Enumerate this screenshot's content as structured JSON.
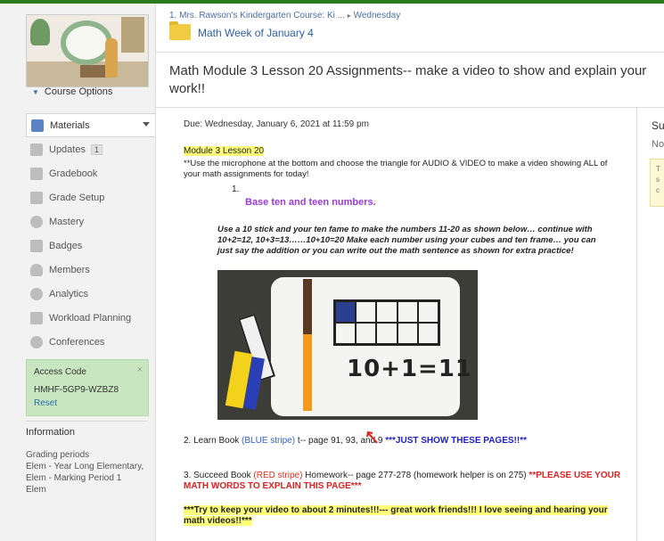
{
  "sidebar": {
    "course_options": "Course Options",
    "items": [
      {
        "label": "Materials",
        "active": true,
        "icon": "materials-icon"
      },
      {
        "label": "Updates",
        "count": "1",
        "icon": "updates-icon"
      },
      {
        "label": "Gradebook",
        "icon": "gradebook-icon"
      },
      {
        "label": "Grade Setup",
        "icon": "grade-setup-icon"
      },
      {
        "label": "Mastery",
        "icon": "mastery-icon"
      },
      {
        "label": "Badges",
        "icon": "badge-icon"
      },
      {
        "label": "Members",
        "icon": "members-icon"
      },
      {
        "label": "Analytics",
        "icon": "analytics-icon"
      },
      {
        "label": "Workload Planning",
        "icon": "workload-icon"
      },
      {
        "label": "Conferences",
        "icon": "conferences-icon"
      }
    ],
    "access_code": {
      "title": "Access Code",
      "code": "HMHF-5GP9-WZBZ8",
      "reset": "Reset",
      "close": "×"
    },
    "information": {
      "title": "Information",
      "grading_periods_label": "Grading periods",
      "periods": [
        "Elem - Year Long Elementary,",
        "Elem - Marking Period 1",
        "Elem"
      ]
    }
  },
  "header": {
    "breadcrumb_course": "1. Mrs. Rawson's Kindergarten Course: Ki ...",
    "breadcrumb_sep": "▸",
    "breadcrumb_folder": "Wednesday",
    "folder_title": "Math Week of January 4",
    "page_title": "Math Module 3 Lesson 20 Assignments-- make a video to show and explain your work!!"
  },
  "right_col": {
    "sub": "Sub",
    "no": "No",
    "yellow_lines": [
      "T",
      "s",
      "c"
    ]
  },
  "assignment": {
    "due": "Due: Wednesday, January 6, 2021 at 11:59 pm",
    "module": "Module 3  Lesson 20",
    "instructions": "**Use the microphone at the bottom and choose the triangle for AUDIO & VIDEO to make a video showing ALL of your math assignments for today!",
    "list_num": "1.",
    "base_ten": "Base ten and teen numbers.",
    "bold_instructions": "Use a 10 stick and your ten fame to make the numbers 11-20 as shown below… continue with 10+2=12, 10+3=13……10+10=20 Make each number using your cubes and ten frame… you can just say the addition or you can write out the math sentence as shown for extra practice!",
    "photo_equation": "10+1=11",
    "learn_prefix": "2.  Learn Book ",
    "learn_stripe": "(BLUE stripe)",
    "learn_pages": " t-- page 91, 93, and ",
    "learn_pages_end": "9",
    "learn_show": "***JUST SHOW THESE PAGES!!**",
    "succeed_prefix": "3.  Succeed Book ",
    "succeed_stripe": "(RED stripe)",
    "succeed_pages": " Homework-- page 277-278  (homework helper is on 275) ",
    "succeed_words": "**PLEASE USE YOUR MATH WORDS TO EXPLAIN THIS PAGE***",
    "try": "***Try to keep your video to about 2 minutes!!!--- great work friends!!!  I love seeing and hearing your math videos!!***"
  },
  "colors": {
    "accent_green": "#2b7a1e",
    "link_blue": "#2d5fa0",
    "purple": "#9b3bd6",
    "red": "#e02020",
    "highlight": "#ffff7a"
  }
}
